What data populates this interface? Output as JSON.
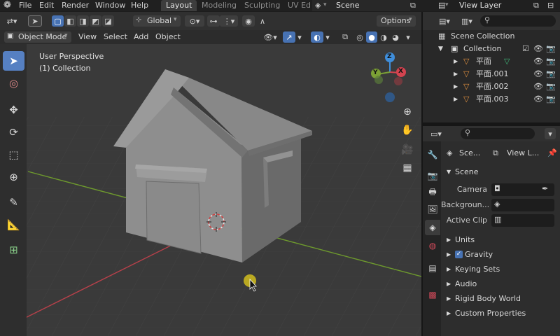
{
  "menu": [
    "File",
    "Edit",
    "Render",
    "Window",
    "Help"
  ],
  "workspaces": [
    {
      "label": "Layout",
      "active": true
    },
    {
      "label": "Modeling",
      "active": false
    },
    {
      "label": "Sculpting",
      "active": false
    },
    {
      "label": "UV Ed",
      "active": false
    }
  ],
  "scene_name": "Scene",
  "view_layer_name": "View Layer",
  "viewport": {
    "transform_orientation": "Global",
    "options_label": "Options",
    "mode": "Object Mode",
    "header_menu": [
      "View",
      "Select",
      "Add",
      "Object"
    ],
    "info_line1": "User Perspective",
    "info_line2": "(1) Collection",
    "gizmo_axes": {
      "x": "X",
      "y": "Y",
      "z": "Z"
    }
  },
  "outliner": {
    "root": "Scene Collection",
    "collection": "Collection",
    "objects": [
      "平面",
      "平面.001",
      "平面.002",
      "平面.003"
    ]
  },
  "properties": {
    "breadcrumb_scene": "Sce...",
    "breadcrumb_layer": "View L...",
    "panel": "Scene",
    "fields": [
      {
        "label": "Camera"
      },
      {
        "label": "Backgroun..."
      },
      {
        "label": "Active Clip"
      }
    ],
    "collapsed_panels": [
      "Units",
      "Gravity",
      "Keying Sets",
      "Audio",
      "Rigid Body World",
      "Custom Properties"
    ]
  },
  "colors": {
    "accent_blue": "#4772b3",
    "axis_x": "#d4434f",
    "axis_y": "#7ca135",
    "axis_z": "#3f8edb",
    "object_orange": "#e2913f",
    "mesh_green": "#3fb87a",
    "cursor_yellow": "#c9b61f"
  }
}
